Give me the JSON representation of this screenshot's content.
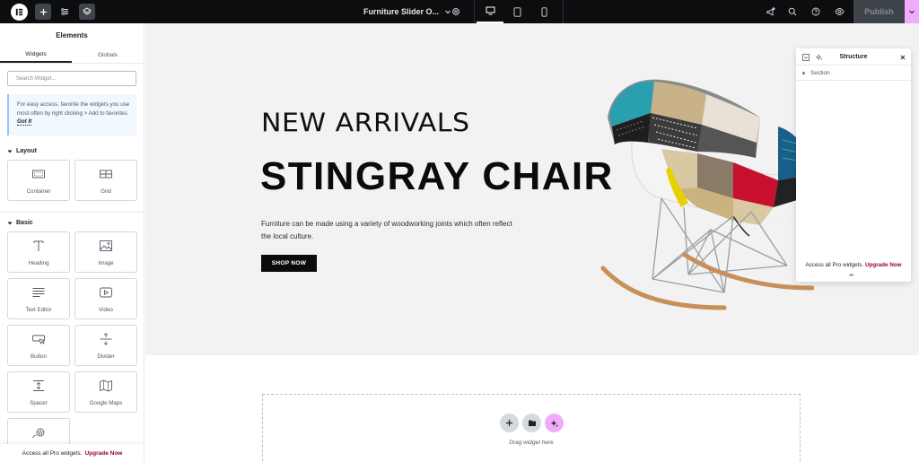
{
  "toolbar": {
    "document_title": "Furniture Slider O...",
    "publish_label": "Publish"
  },
  "panel": {
    "title": "Elements",
    "tabs": [
      "Widgets",
      "Globals"
    ],
    "search_placeholder": "Search Widget...",
    "tip_text": "For easy access, favorite the widgets you use most often by right clicking > Add to favorites.",
    "tip_link": "Got It",
    "categories": {
      "layout": {
        "label": "Layout",
        "widgets": [
          "Container",
          "Grid"
        ]
      },
      "basic": {
        "label": "Basic",
        "widgets": [
          "Heading",
          "Image",
          "Text Editor",
          "Video",
          "Button",
          "Divider",
          "Spacer",
          "Google Maps"
        ]
      }
    },
    "footer_text": "Access all Pro widgets.",
    "footer_link": "Upgrade Now"
  },
  "hero": {
    "kicker": "NEW ARRIVALS",
    "headline": "STINGRAY CHAIR",
    "description": "Furniture can be made using a variety of woodworking joints which often reflect the local culture.",
    "button": "SHOP NOW"
  },
  "dropzone": {
    "text": "Drag widget here"
  },
  "structure": {
    "title": "Structure",
    "items": [
      "Section"
    ],
    "footer_text": "Access all Pro widgets.",
    "footer_link": "Upgrade Now"
  },
  "colors": {
    "topbar": "#0c0d0e",
    "accent_pink": "#f0abfc",
    "upgrade_link": "#93003f",
    "hero_bg": "#f2f2f2"
  }
}
